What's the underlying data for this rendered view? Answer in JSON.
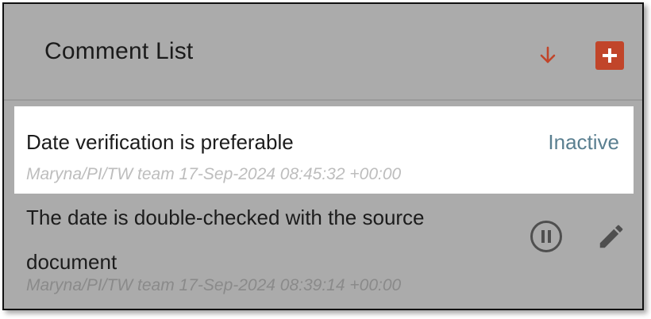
{
  "header": {
    "title": "Comment List"
  },
  "comments": [
    {
      "text": "Date verification is preferable",
      "status": "Inactive",
      "meta": "Maryna/PI/TW team 17-Sep-2024 08:45:32 +00:00"
    },
    {
      "text": "The date is double-checked with the source document",
      "meta": "Maryna/PI/TW team 17-Sep-2024 08:39:14 +00:00"
    }
  ],
  "icons": {
    "sort": "arrow-down-icon",
    "add": "plus-icon",
    "pause": "pause-circle-icon",
    "edit": "pencil-icon"
  },
  "colors": {
    "accent": "#c1452a",
    "status": "#5a7f90",
    "overlay": "#ababab"
  }
}
